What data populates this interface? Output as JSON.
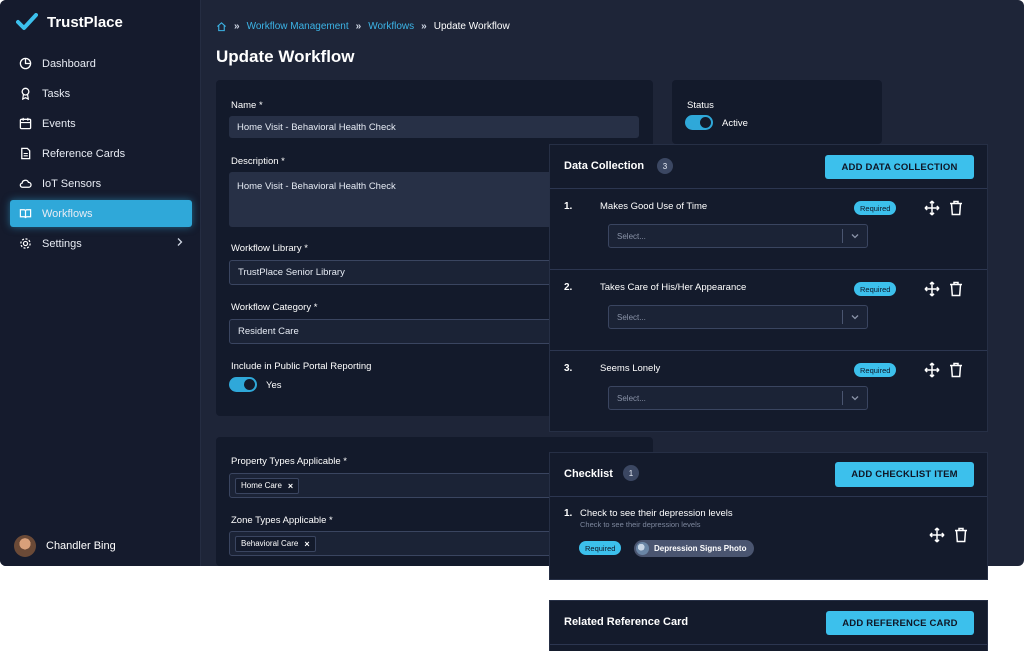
{
  "brand": {
    "name": "TrustPlace",
    "accent": "#3cc0ec"
  },
  "sidebar": {
    "items": [
      {
        "label": "Dashboard",
        "icon": "pie-chart-icon"
      },
      {
        "label": "Tasks",
        "icon": "award-icon"
      },
      {
        "label": "Events",
        "icon": "calendar-icon"
      },
      {
        "label": "Reference Cards",
        "icon": "document-icon"
      },
      {
        "label": "IoT Sensors",
        "icon": "cloud-icon"
      },
      {
        "label": "Workflows",
        "icon": "book-icon",
        "active": true
      },
      {
        "label": "Settings",
        "icon": "gear-icon",
        "has_submenu": true
      }
    ],
    "user": {
      "name": "Chandler Bing"
    }
  },
  "breadcrumb": {
    "home_icon": "home-icon",
    "items": [
      "Workflow Management",
      "Workflows",
      "Update Workflow"
    ],
    "separator": "»"
  },
  "page": {
    "title": "Update Workflow"
  },
  "form": {
    "name_label": "Name *",
    "name_value": "Home Visit - Behavioral Health Check",
    "description_label": "Description *",
    "description_value": "Home Visit - Behavioral Health Check",
    "library_label": "Workflow Library *",
    "library_value": "TrustPlace Senior Library",
    "category_label": "Workflow Category *",
    "category_value": "Resident Care",
    "portal_label": "Include in Public Portal Reporting",
    "portal_toggle_text": "Yes",
    "portal_on": true
  },
  "status": {
    "label": "Status",
    "toggle_text": "Active",
    "on": true
  },
  "applicability": {
    "property_label": "Property Types Applicable *",
    "property_chips": [
      "Home Care"
    ],
    "zone_label": "Zone Types Applicable *",
    "zone_chips": [
      "Behavioral Care"
    ],
    "chip_remove": "×"
  },
  "data_collection": {
    "title": "Data Collection",
    "count": "3",
    "add_button": "ADD DATA COLLECTION",
    "items": [
      {
        "num": "1.",
        "text": "Makes Good Use of Time",
        "badge": "Required",
        "placeholder": "Select..."
      },
      {
        "num": "2.",
        "text": "Takes Care of His/Her Appearance",
        "badge": "Required",
        "placeholder": "Select..."
      },
      {
        "num": "3.",
        "text": "Seems Lonely",
        "badge": "Required",
        "placeholder": "Select..."
      }
    ]
  },
  "checklist": {
    "title": "Checklist",
    "count": "1",
    "add_button": "ADD CHECKLIST ITEM",
    "items": [
      {
        "num": "1.",
        "text": "Check to see their depression levels",
        "subtext": "Check to see their depression levels",
        "badge": "Required",
        "attachment": "Depression Signs Photo"
      }
    ]
  },
  "reference": {
    "title": "Related Reference Card",
    "add_button": "ADD REFERENCE CARD"
  }
}
